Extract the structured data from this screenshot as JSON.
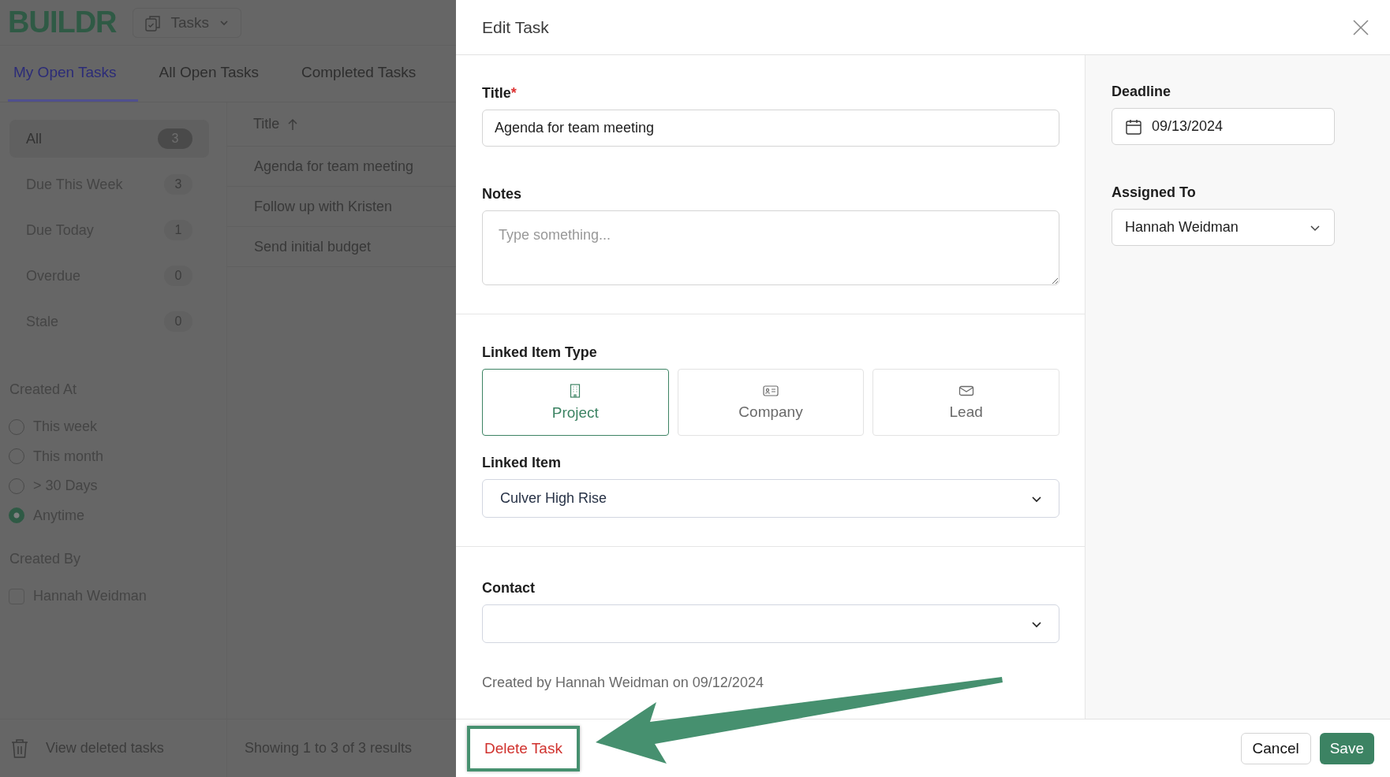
{
  "app": {
    "logo": "BUILDR",
    "module": "Tasks"
  },
  "tabs": [
    {
      "label": "My Open Tasks",
      "selected": true
    },
    {
      "label": "All Open Tasks",
      "selected": false
    },
    {
      "label": "Completed Tasks",
      "selected": false
    }
  ],
  "filters": [
    {
      "label": "All",
      "count": "3",
      "selected": true
    },
    {
      "label": "Due This Week",
      "count": "3",
      "selected": false
    },
    {
      "label": "Due Today",
      "count": "1",
      "selected": false
    },
    {
      "label": "Overdue",
      "count": "0",
      "selected": false
    },
    {
      "label": "Stale",
      "count": "0",
      "selected": false
    }
  ],
  "created_at": {
    "heading": "Created At",
    "options": [
      {
        "label": "This week",
        "selected": false
      },
      {
        "label": "This month",
        "selected": false
      },
      {
        "label": "> 30 Days",
        "selected": false
      },
      {
        "label": "Anytime",
        "selected": true
      }
    ]
  },
  "created_by": {
    "heading": "Created By",
    "options": [
      {
        "label": "Hannah Weidman",
        "checked": false
      }
    ]
  },
  "view_deleted": "View deleted tasks",
  "table": {
    "column": "Title",
    "rows": [
      "Agenda for team meeting",
      "Follow up with Kristen",
      "Send initial budget"
    ]
  },
  "pagination": "Showing 1 to 3 of 3 results",
  "modal": {
    "title": "Edit Task",
    "title_field": {
      "label": "Title",
      "required_mark": "*",
      "value": "Agenda for team meeting"
    },
    "notes": {
      "label": "Notes",
      "placeholder": "Type something..."
    },
    "linked_item_type": {
      "label": "Linked Item Type",
      "options": [
        {
          "label": "Project",
          "kind": "building",
          "selected": true
        },
        {
          "label": "Company",
          "kind": "card",
          "selected": false
        },
        {
          "label": "Lead",
          "kind": "mail",
          "selected": false
        }
      ]
    },
    "linked_item": {
      "label": "Linked Item",
      "value": "Culver High Rise"
    },
    "contact": {
      "label": "Contact"
    },
    "created_note": "Created by Hannah Weidman on 09/12/2024",
    "deadline": {
      "label": "Deadline",
      "value": "09/13/2024"
    },
    "assigned_to": {
      "label": "Assigned To",
      "value": "Hannah Weidman"
    },
    "delete_button": "Delete Task",
    "cancel_button": "Cancel",
    "save_button": "Save"
  }
}
